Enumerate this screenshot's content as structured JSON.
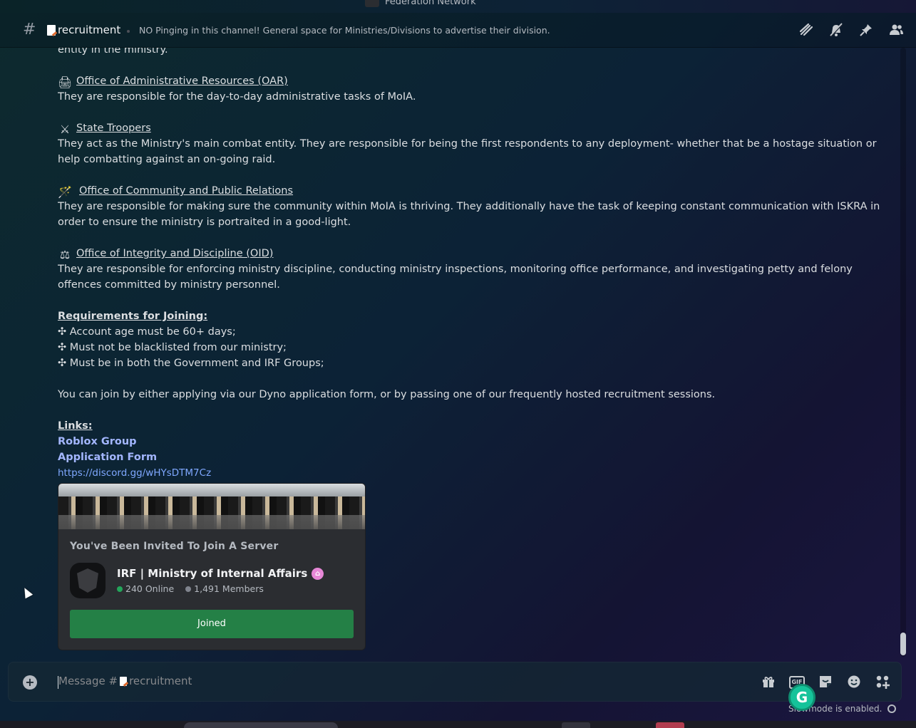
{
  "window": {
    "server_name": "Federation Network"
  },
  "header": {
    "channel_name": "recruitment",
    "topic": "NO Pinging in this channel! General space for Ministries/Divisions to advertise their division.",
    "icons": [
      "threads-icon",
      "notifications-muted-icon",
      "pin-icon",
      "member-list-icon"
    ]
  },
  "message": {
    "partial_top_line": "entity in the ministry.",
    "sections": [
      {
        "emoji": "printer",
        "emoji_glyph": "🖨",
        "title": "Office of Administrative Resources  (OAR)",
        "text": "They are responsible for the day-to-day administrative tasks of MoIA."
      },
      {
        "emoji": "crossed-swords",
        "emoji_glyph": "⚔",
        "title": "State Troopers",
        "text": "They act as the Ministry's main combat entity. They are responsible for being the first respondents to any deployment- whether that be a hostage situation or help combatting against an on-going raid."
      },
      {
        "emoji": "magic-wand",
        "emoji_glyph": "🪄",
        "title": "Office of Community and Public Relations",
        "text": "They are responsible for making sure the community within MoIA is thriving. They additionally have the task of keeping constant communication with ISKRA in order to ensure the ministry is portraited in a good-light."
      },
      {
        "emoji": "scales",
        "emoji_glyph": "⚖",
        "title": "Office of Integrity and Discipline (OID)",
        "text": "They are responsible for enforcing ministry discipline, conducting ministry inspections, monitoring office performance, and investigating petty and felony offences committed by ministry personnel."
      }
    ],
    "requirements_heading": "Requirements for Joining:",
    "requirements": [
      "✣ Account age must be 60+ days;",
      "✣ Must not be blacklisted from our ministry;",
      "✣ Must be in both the Government and IRF Groups;"
    ],
    "join_text": "You can join by either applying via our Dyno application form, or by passing one of our frequently hosted recruitment sessions.",
    "links_heading": "Links:",
    "links": [
      "Roblox Group",
      "Application Form"
    ],
    "invite_url": "https://discord.gg/wHYsDTM7Cz"
  },
  "invite": {
    "heading": "You've Been Invited To Join A Server",
    "server_name": "IRF | Ministry of Internal Affairs",
    "online": "240 Online",
    "members": "1,491 Members",
    "button_label": "Joined",
    "online_color": "#23a55a",
    "members_color": "#80848e"
  },
  "composer": {
    "placeholder_prefix": "Message #",
    "placeholder_channel": "recruitment",
    "gif_label": "GIF",
    "icons": [
      "add-attachment-icon",
      "gift-icon",
      "gif-icon",
      "sticker-icon",
      "emoji-icon",
      "apps-icon"
    ]
  },
  "footer": {
    "slowmode_text": "Slowmode is enabled."
  }
}
